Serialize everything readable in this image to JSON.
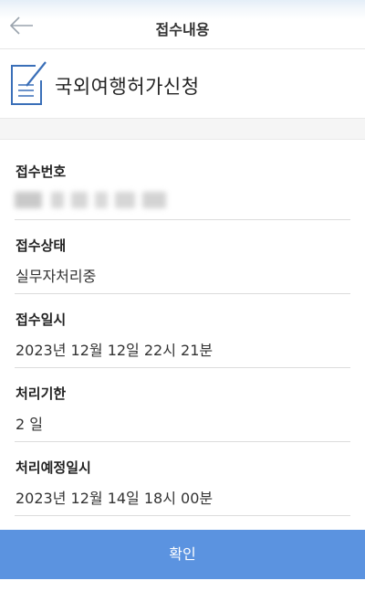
{
  "header": {
    "title": "접수내용",
    "back_icon": "arrow-left-icon"
  },
  "document": {
    "icon": "document-edit-icon",
    "title": "국외여행허가신청"
  },
  "fields": [
    {
      "label": "접수번호",
      "value": "",
      "redacted": true
    },
    {
      "label": "접수상태",
      "value": "실무자처리중"
    },
    {
      "label": "접수일시",
      "value": "2023년 12월 12일 22시 21분"
    },
    {
      "label": "처리기한",
      "value": "2 일"
    },
    {
      "label": "처리예정일시",
      "value": "2023년 12월 14일 18시 00분"
    }
  ],
  "footer": {
    "confirm_label": "확인"
  },
  "colors": {
    "accent": "#5b93e0",
    "icon": "#3a6fb8"
  }
}
